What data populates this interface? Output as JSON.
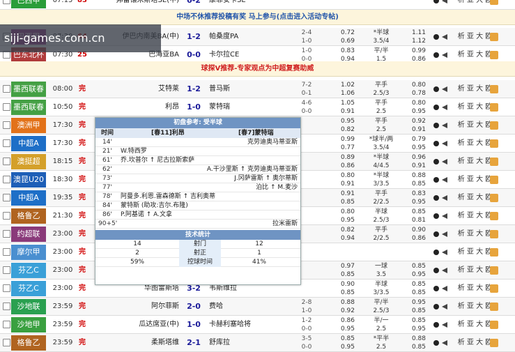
{
  "watermark": "siji-games.com.cn",
  "banners": [
    {
      "text": "中场不休推荐投稿有奖 马上参与(点击进入活动专帖)",
      "color": "#2255aa"
    },
    {
      "text": "球探V推荐-专家观点为中超复赛助威",
      "color": "#d02020"
    }
  ],
  "rows": [
    {
      "league": "巴西甲",
      "color": "#2a9d3a",
      "time": "07:15",
      "status": "83",
      "home": "弗雷镶米斯塔SE(中)",
      "score": "0-2",
      "away": "康菲安卡SE",
      "half": "0-2",
      "o1": [
        "1.72",
        ""
      ],
      "o2": [
        "4.5",
        ""
      ],
      "o3": [
        "0.38",
        ""
      ],
      "bookie": "析 亚 大 欧"
    },
    {
      "league": "巴西甲",
      "color": "#9d3a8f",
      "time": "07:30",
      "status": "64",
      "home": "伊巴内南美BA(中)",
      "score": "1-2",
      "away": "帕桑度PA",
      "half": "2-4 1-0",
      "o1": [
        "0.72",
        "0.69"
      ],
      "o2": [
        "*半球",
        "3.5/4"
      ],
      "o3": [
        "1.11",
        "1.12"
      ],
      "bookie": "析 亚 大 欧"
    },
    {
      "league": "巴东北杯",
      "color": "#b03b3b",
      "time": "07:30",
      "status": "25",
      "home": "巴海亚BA",
      "score": "0-0",
      "away": "卡尔拉CE",
      "half": "1-0 0-0",
      "o1": [
        "0.83",
        "0.94"
      ],
      "o2": [
        "平/半",
        "1.5"
      ],
      "o3": [
        "0.99",
        "0.86"
      ],
      "bookie": "析 亚 大 欧"
    },
    {
      "league": "墨西联春",
      "color": "#44a044",
      "time": "08:00",
      "status": "完",
      "home": "艾特莱",
      "score": "1-2",
      "away": "普马斯",
      "half": "7-2 0-1",
      "o1": [
        "1.02",
        "1.06"
      ],
      "o2": [
        "平手",
        "2.5/3"
      ],
      "o3": [
        "0.80",
        "0.78"
      ],
      "bookie": "析 亚 大 欧"
    },
    {
      "league": "墨西联春",
      "color": "#44a044",
      "time": "10:50",
      "status": "完",
      "home": "利昂",
      "score": "1-0",
      "away": "蒙特瑞",
      "half": "4-6 0-0",
      "o1": [
        "1.05",
        "0.91"
      ],
      "o2": [
        "平手",
        "2.5"
      ],
      "o3": [
        "0.80",
        "0.95"
      ],
      "bookie": "析 亚 大 欧"
    },
    {
      "league": "澳洲甲",
      "color": "#e2721a",
      "time": "17:30",
      "status": "完",
      "home": "",
      "score": "",
      "away": "",
      "half": "",
      "o1": [
        "0.95",
        "0.82"
      ],
      "o2": [
        "平手",
        "2.5"
      ],
      "o3": [
        "0.92",
        "0.91"
      ],
      "bookie": "析 亚 大 欧"
    },
    {
      "league": "中超A",
      "color": "#1e6fc7",
      "time": "17:30",
      "status": "完",
      "home": "",
      "score": "",
      "away": "",
      "half": "",
      "o1": [
        "0.99",
        "0.77"
      ],
      "o2": [
        "*球半/两",
        "3.5/4"
      ],
      "o3": [
        "0.79",
        "0.95"
      ],
      "bookie": "析 亚 大 欧"
    },
    {
      "league": "澳挺超",
      "color": "#d4a02a",
      "time": "18:15",
      "status": "完",
      "home": "",
      "score": "",
      "away": "",
      "half": "",
      "o1": [
        "0.89",
        "0.86"
      ],
      "o2": [
        "*半球",
        "4/4.5"
      ],
      "o3": [
        "0.96",
        "0.91"
      ],
      "bookie": "析 亚 大 欧"
    },
    {
      "league": "澳昆U20",
      "color": "#1e5fb7",
      "time": "18:30",
      "status": "完",
      "home": "",
      "score": "",
      "away": "",
      "half": "",
      "o1": [
        "0.80",
        "0.91"
      ],
      "o2": [
        "*半球",
        "3/3.5"
      ],
      "o3": [
        "0.88",
        "0.85"
      ],
      "bookie": "析 亚 大 欧"
    },
    {
      "league": "中超A",
      "color": "#1e6fc7",
      "time": "19:35",
      "status": "完",
      "home": "",
      "score": "",
      "away": "",
      "half": "",
      "o1": [
        "0.91",
        "0.85"
      ],
      "o2": [
        "平手",
        "2/2.5"
      ],
      "o3": [
        "0.83",
        "0.95"
      ],
      "bookie": "析 亚 大 欧"
    },
    {
      "league": "格鲁乙",
      "color": "#b06420",
      "time": "21:30",
      "status": "完",
      "home": "",
      "score": "",
      "away": "",
      "half": "",
      "o1": [
        "0.80",
        "0.95"
      ],
      "o2": [
        "半球",
        "2.5/3"
      ],
      "o3": [
        "0.85",
        "0.81"
      ],
      "bookie": "析 亚 大 欧"
    },
    {
      "league": "约超联",
      "color": "#8a3a7a",
      "time": "23:00",
      "status": "完",
      "home": "",
      "score": "",
      "away": "",
      "half": "",
      "o1": [
        "0.82",
        "0.94"
      ],
      "o2": [
        "平手",
        "2/2.5"
      ],
      "o3": [
        "0.90",
        "0.86"
      ],
      "bookie": "析 亚 大 欧"
    },
    {
      "league": "摩尔甲",
      "color": "#4a8fd0",
      "time": "23:00",
      "status": "完",
      "home": "",
      "score": "",
      "away": "",
      "half": "",
      "o1": [
        "",
        ""
      ],
      "o2": [
        "",
        ""
      ],
      "o3": [
        "",
        ""
      ],
      "bookie": "析 亚 大 欧"
    },
    {
      "league": "芬乙C",
      "color": "#3aa0d8",
      "time": "23:00",
      "status": "完",
      "home": "",
      "score": "",
      "away": "",
      "half": "",
      "o1": [
        "0.97",
        "0.85"
      ],
      "o2": [
        "一球",
        "3.5"
      ],
      "o3": [
        "0.85",
        "0.95"
      ],
      "bookie": "析 亚 大 欧"
    },
    {
      "league": "芬乙C",
      "color": "#3aa0d8",
      "time": "23:00",
      "status": "完",
      "home": "华图雷斯塔",
      "score": "3-2",
      "away": "韦斯维拉",
      "half": "",
      "o1": [
        "0.90",
        "0.85"
      ],
      "o2": [
        "半球",
        "3/3.5"
      ],
      "o3": [
        "0.85",
        "0.85"
      ],
      "bookie": "析 亚 大 欧"
    },
    {
      "league": "沙地联",
      "color": "#2aa050",
      "time": "23:59",
      "status": "完",
      "home": "阿尔菲斯",
      "score": "2-0",
      "away": "费哈",
      "half": "2-8 1-0",
      "o1": [
        "0.88",
        "0.92"
      ],
      "o2": [
        "平/半",
        "2.5/3"
      ],
      "o3": [
        "0.95",
        "0.85"
      ],
      "bookie": "析 亚 大 欧"
    },
    {
      "league": "沙地甲",
      "color": "#3aa040",
      "time": "23:59",
      "status": "完",
      "home": "瓜达席亚(中)",
      "score": "1-0",
      "away": "卡赫利塞哈将",
      "half": "1-2 0-0",
      "o1": [
        "0.86",
        "0.95"
      ],
      "o2": [
        "半/一",
        "2.5"
      ],
      "o3": [
        "0.85",
        "0.95"
      ],
      "bookie": "析 亚 大 欧"
    },
    {
      "league": "格鲁乙",
      "color": "#b06420",
      "time": "23:59",
      "status": "完",
      "home": "柔斯塔维",
      "score": "2-1",
      "away": "舒库拉",
      "half": "3-5 0-0",
      "o1": [
        "0.85",
        "0.95"
      ],
      "o2": [
        "*平半",
        "2.5"
      ],
      "o3": [
        "0.88",
        "0.85"
      ],
      "bookie": "析 亚 大 欧"
    }
  ],
  "popup": {
    "title": "初盘参考: 受半球",
    "head_time": "时间",
    "head_home": "[春11]利昂",
    "head_away": "[春7]蒙特瑞",
    "events": [
      {
        "t": "14'",
        "l": "",
        "r": "克劳迪奥马蒂亚斯"
      },
      {
        "t": "21'",
        "l": "W.特西罗",
        "r": ""
      },
      {
        "t": "61'",
        "l": "乔.坎普尔 ↑ 尼古拉斯索萨",
        "r": ""
      },
      {
        "t": "62'",
        "l": "",
        "r": "A.干沙里斯 ↑ 克劳迪奥马蒂亚斯"
      },
      {
        "t": "73'",
        "l": "",
        "r": "J.冈萨雷斯 ↑ 奥尔蒂斯"
      },
      {
        "t": "77'",
        "l": "",
        "r": "泊比 ↑ M.麦沙"
      },
      {
        "t": "78'",
        "l": "阿曼多.利恩.雷森德斯 ↑ 吉利奥蒂",
        "r": ""
      },
      {
        "t": "84'",
        "l": "蒙特斯 (助攻:吉尔.布隆)",
        "r": ""
      },
      {
        "t": "86'",
        "l": "P.阿基诺 ↑ A.文拿",
        "r": ""
      },
      {
        "t": "90+5'",
        "l": "",
        "r": "拉米雷斯"
      }
    ],
    "stats_title": "技术统计",
    "stats": [
      {
        "home": "14",
        "label": "射门",
        "away": "12"
      },
      {
        "home": "2",
        "label": "射正",
        "away": "1"
      },
      {
        "home": "59%",
        "label": "控球时间",
        "away": "41%"
      }
    ]
  }
}
